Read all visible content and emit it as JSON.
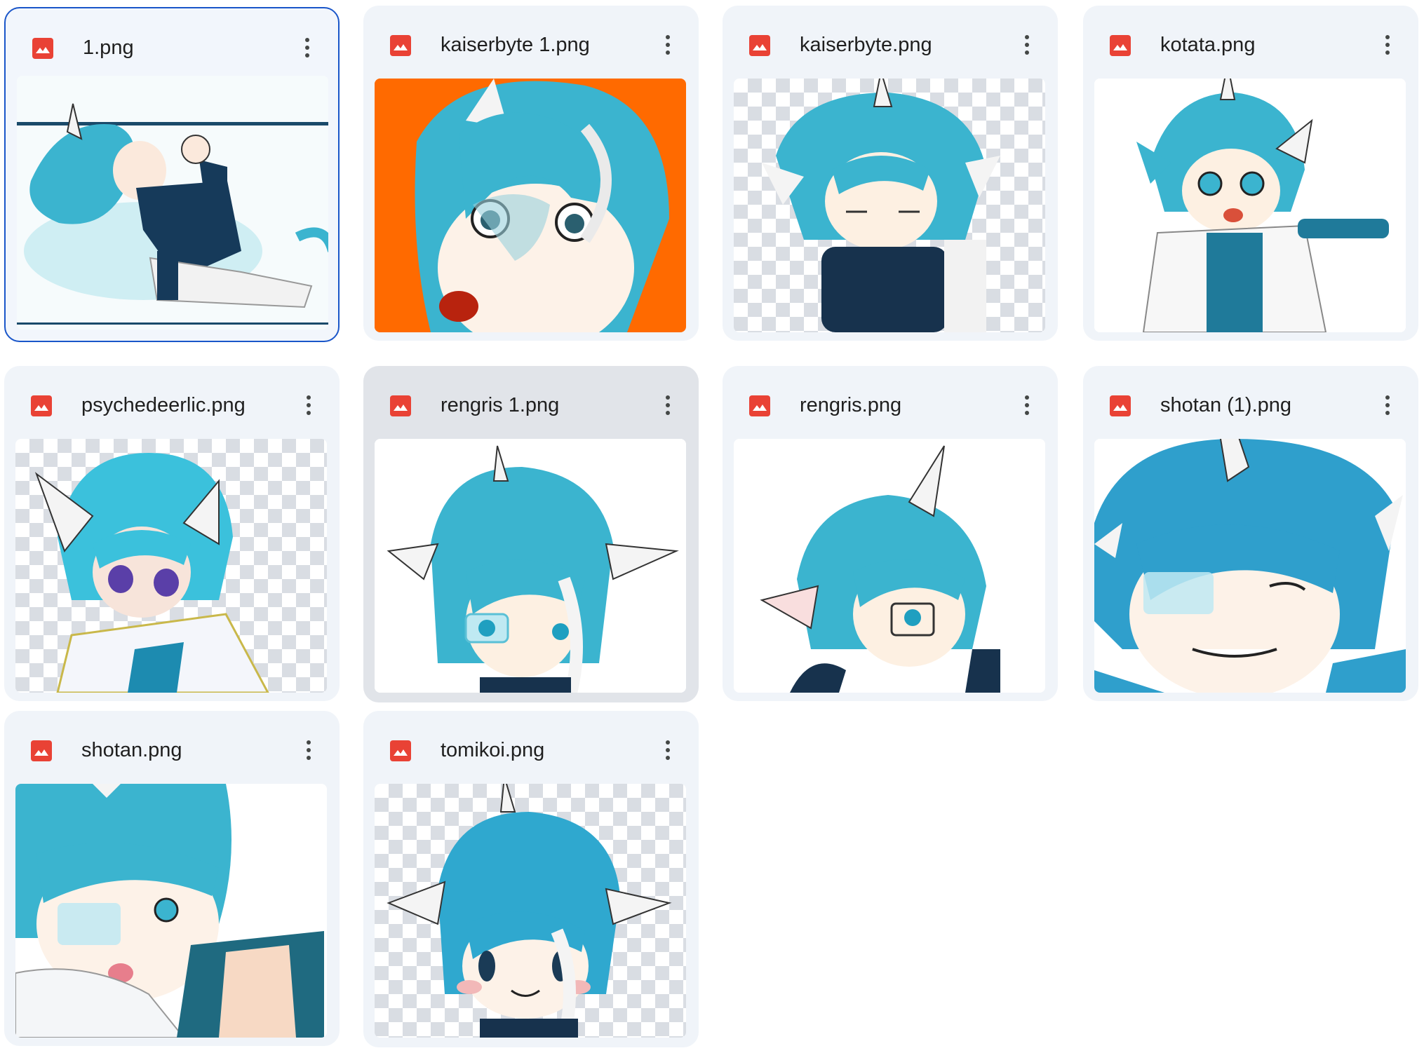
{
  "files": [
    {
      "name": "1.png",
      "icon": "image-file-icon",
      "state": "selected",
      "thumb_bg": "#ffffff"
    },
    {
      "name": "kaiserbyte 1.png",
      "icon": "image-file-icon",
      "thumb_bg": "#ff6a00"
    },
    {
      "name": "kaiserbyte.png",
      "icon": "image-file-icon",
      "thumb_bg": "transparent"
    },
    {
      "name": "kotata.png",
      "icon": "image-file-icon",
      "thumb_bg": "#ffffff"
    },
    {
      "name": "psychedeerlic.png",
      "icon": "image-file-icon",
      "thumb_bg": "transparent"
    },
    {
      "name": "rengris 1.png",
      "icon": "image-file-icon",
      "state": "hovered",
      "thumb_bg": "#ffffff"
    },
    {
      "name": "rengris.png",
      "icon": "image-file-icon",
      "thumb_bg": "#ffffff"
    },
    {
      "name": "shotan (1).png",
      "icon": "image-file-icon",
      "thumb_bg": "#ffffff"
    },
    {
      "name": "shotan.png",
      "icon": "image-file-icon",
      "thumb_bg": "#ffffff"
    },
    {
      "name": "tomikoi.png",
      "icon": "image-file-icon",
      "thumb_bg": "transparent"
    }
  ],
  "colors": {
    "card_bg": "#f0f4f9",
    "card_hover_bg": "#e1e4e9",
    "selected_border": "#1a56c9",
    "file_icon_red": "#e94235",
    "hair_teal": "#3bb4cf"
  }
}
